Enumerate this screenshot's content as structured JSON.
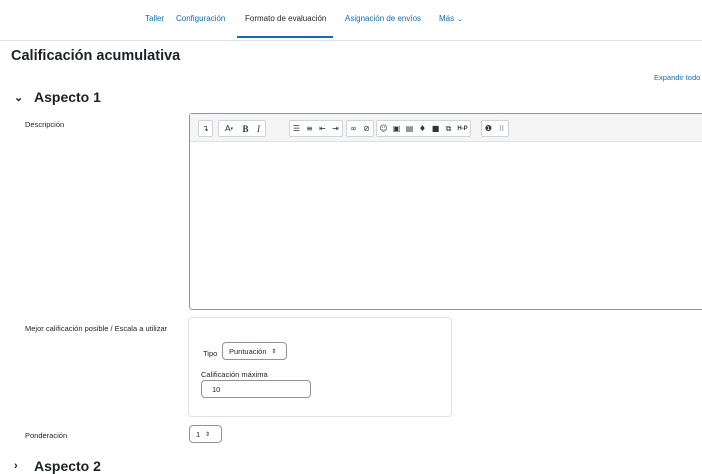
{
  "nav": {
    "tabs": [
      {
        "label": "Taller"
      },
      {
        "label": "Configuración"
      },
      {
        "label": "Formato de evaluación"
      },
      {
        "label": "Asignación de envíos"
      },
      {
        "label": "Más"
      }
    ],
    "active_tab": "Formato de evaluación"
  },
  "page": {
    "title": "Calificación acumulativa",
    "expand_all": "Expandir todo"
  },
  "aspecto1": {
    "title": "Aspecto 1",
    "descripcion_label": "Descripción",
    "editor_value": "",
    "grade_label": "Mejor calificación posible / Escala a utilizar",
    "tipo_label": "Tipo",
    "tipo_value": "Puntuación",
    "max_label": "Calificación máxima",
    "max_value": "10",
    "ponderacion_label": "Ponderación",
    "ponderacion_value": "1"
  },
  "aspecto2": {
    "title": "Aspecto 2"
  },
  "toolbar": {
    "text_a": "A",
    "bold": "B",
    "italic": "I",
    "h5p": "H-P"
  },
  "colors": {
    "link": "#0f6cbf",
    "text": "#1d2125",
    "border": "#dee2e6"
  }
}
